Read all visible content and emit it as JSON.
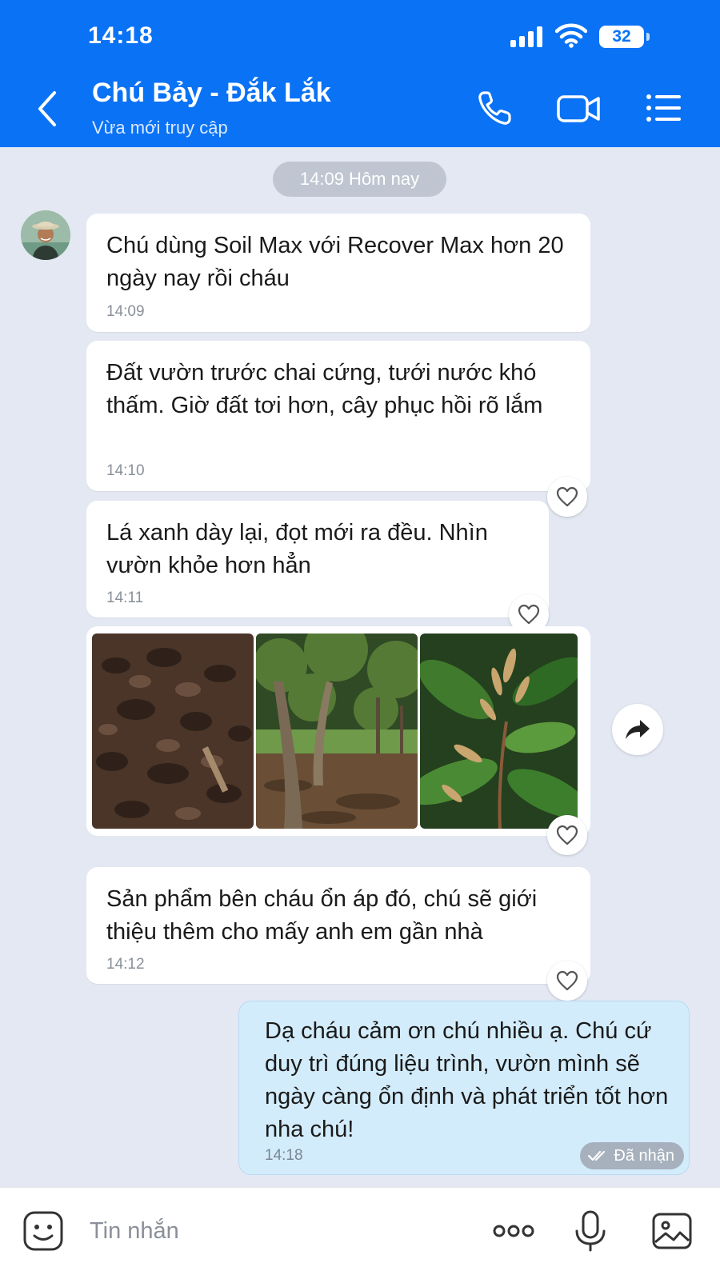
{
  "status_bar": {
    "time": "14:18",
    "battery": "32"
  },
  "header": {
    "contact_name": "Chú Bảy - Đắk Lắk",
    "contact_status": "Vừa mới truy cập",
    "icons": [
      "back-icon",
      "phone-icon",
      "video-call-icon",
      "menu-list-icon"
    ]
  },
  "chat": {
    "date_divider": "14:09 Hôm nay",
    "messages": [
      {
        "text": "Chú dùng Soil Max với Recover Max hơn 20 ngày nay rồi cháu",
        "time": "14:09"
      },
      {
        "text": "Đất vườn trước chai cứng, tưới nước khó thấm. Giờ đất tơi hơn, cây phục hồi rõ lắm",
        "time": "14:10"
      },
      {
        "text": "Lá xanh dày lại, đọt mới ra đều. Nhìn vườn khỏe hơn hẳn",
        "time": "14:11"
      },
      {
        "text": "Sản phẩm bên cháu ổn áp đó, chú sẽ giới thiệu thêm cho mấy anh em gần nhà",
        "time": "14:12"
      }
    ],
    "photos": [
      "soil-photo",
      "orchard-photo",
      "leaves-photo"
    ],
    "outgoing": {
      "text": "Dạ cháu cảm ơn chú nhiều ạ. Chú cứ duy trì đúng liệu trình, vườn mình sẽ ngày càng ổn định và phát triển tốt hơn nha chú!",
      "time": "14:18",
      "status": "Đã nhận"
    }
  },
  "input_bar": {
    "placeholder": "Tin nhắn",
    "icons": [
      "sticker-icon",
      "more-icon",
      "microphone-icon",
      "image-icon"
    ]
  },
  "colors": {
    "header_blue": "#0a72f5",
    "chat_background": "#e3e8f2",
    "outgoing_bubble": "#d3ecfb",
    "incoming_bubble": "#ffffff"
  }
}
